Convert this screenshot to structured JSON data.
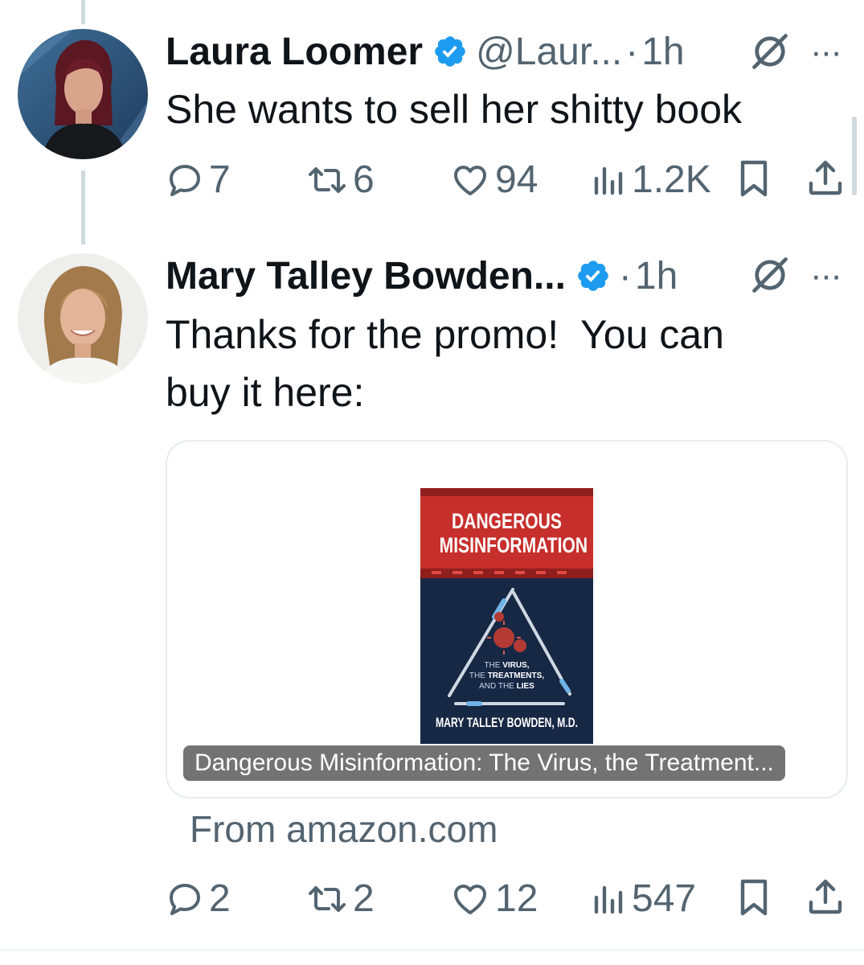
{
  "tweets": [
    {
      "author": "Laura Loomer",
      "handle": "@Laur...",
      "sep": "·",
      "time": "1h",
      "text": "She wants to sell her shitty book",
      "replies": "7",
      "reposts": "6",
      "likes": "94",
      "views": "1.2K"
    },
    {
      "author": "Mary Talley Bowden...",
      "sep": "·",
      "time": "1h",
      "text_line1": "Thanks for the promo!  You can",
      "text_line2": "buy it here:",
      "card": {
        "book_title_line1": "DANGEROUS",
        "book_title_line2": "MISINFORMATION",
        "book_sub1_a": "THE ",
        "book_sub1_b": "VIRUS,",
        "book_sub2_a": "THE ",
        "book_sub2_b": "TREATMENTS,",
        "book_sub3_a": "AND THE ",
        "book_sub3_b": "LIES",
        "book_author": "MARY TALLEY BOWDEN, M.D.",
        "caption": "Dangerous Misinformation: The Virus, the Treatment...",
        "source": "From amazon.com"
      },
      "replies": "2",
      "reposts": "2",
      "likes": "12",
      "views": "547"
    }
  ],
  "icons": {
    "verified": "verified-badge-icon",
    "grok": "grok-icon",
    "more": "more-icon",
    "reply": "reply-icon",
    "repost": "repost-icon",
    "like": "like-icon",
    "views": "views-icon",
    "bookmark": "bookmark-icon",
    "share": "share-icon"
  },
  "colors": {
    "verified_blue": "#1d9bf0",
    "muted_text": "#536471",
    "primary_text": "#0f1419",
    "book_red": "#c62f2c",
    "book_navy": "#1d3150"
  },
  "more_glyph": "···"
}
